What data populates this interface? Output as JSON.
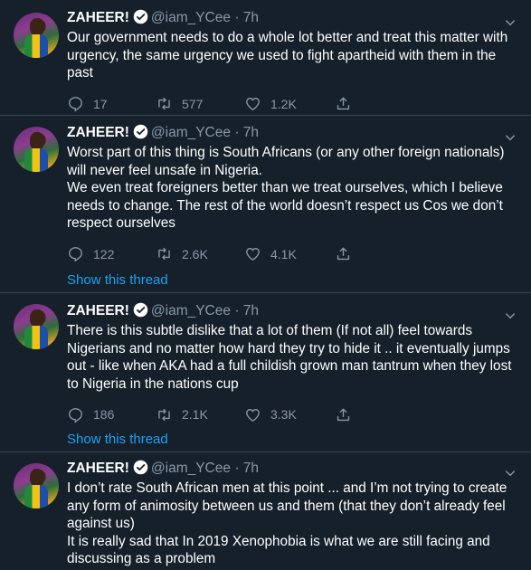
{
  "tweets": [
    {
      "name": "ZAHEER!",
      "handle": "@iam_YCee",
      "dot": "·",
      "time": "7h",
      "text": "Our government needs to do a whole lot better and treat this matter with urgency, the same urgency we used to fight apartheid with them in the past",
      "replies": "17",
      "retweets": "577",
      "likes": "1.2K"
    },
    {
      "name": "ZAHEER!",
      "handle": "@iam_YCee",
      "dot": "·",
      "time": "7h",
      "text": "Worst part of this thing is South Africans (or any other foreign nationals) will never feel unsafe in Nigeria.\nWe even treat foreigners better than we treat ourselves, which I believe needs to change. The rest of the world doesn’t respect us Cos we don’t respect ourselves",
      "replies": "122",
      "retweets": "2.6K",
      "likes": "4.1K",
      "show_thread": "Show this thread"
    },
    {
      "name": "ZAHEER!",
      "handle": "@iam_YCee",
      "dot": "·",
      "time": "7h",
      "text": "There is this subtle dislike that a lot of them (If not all) feel towards Nigerians and no matter how hard they try to hide it .. it eventually jumps out - like when AKA had a full childish grown man tantrum when they lost to Nigeria in the nations cup",
      "replies": "186",
      "retweets": "2.1K",
      "likes": "3.3K",
      "show_thread": "Show this thread"
    },
    {
      "name": "ZAHEER!",
      "handle": "@iam_YCee",
      "dot": "·",
      "time": "7h",
      "text": "I don’t rate South African men at this point ... and I’m not trying to create any form of animosity between us and them (that they don’t already feel against us)\nIt is really sad that In 2019 Xenophobia is what we are still facing and discussing as a problem"
    }
  ],
  "icons": {
    "verified": "verified-badge-icon",
    "reply": "reply-icon",
    "retweet": "retweet-icon",
    "like": "heart-icon",
    "share": "share-icon",
    "more": "chevron-down-icon"
  },
  "colors": {
    "background": "#15202b",
    "text": "#ffffff",
    "muted": "#8899a6",
    "accent": "#1da1f2",
    "divider": "#38444d"
  }
}
